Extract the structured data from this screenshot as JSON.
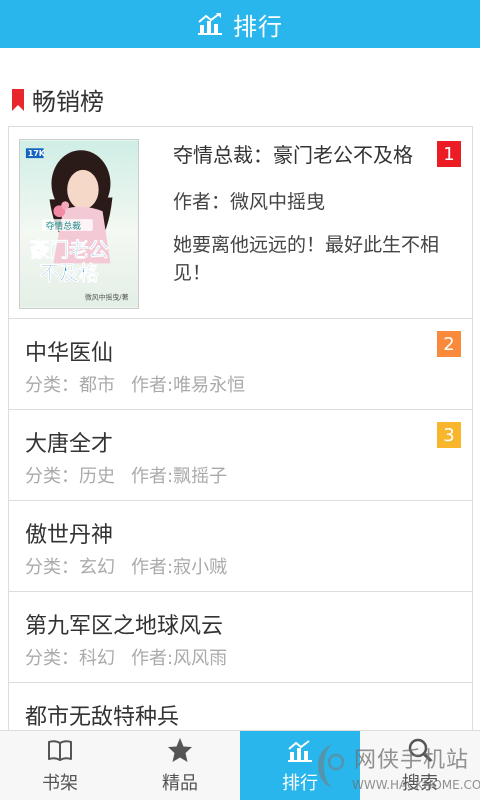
{
  "header": {
    "title": "排行",
    "icon": "bar-chart-icon",
    "color": "#29b6ec"
  },
  "section": {
    "title": "畅销榜",
    "icon": "bookmark-icon",
    "accent": "#e8272d"
  },
  "top_book": {
    "title": "夺情总裁：豪门老公不及格",
    "author": "作者：微风中摇曳",
    "description": " 她要离他远远的！最好此生不相见！",
    "rank": "1",
    "cover": {
      "badge": "17K",
      "title_line1": "豪门老公",
      "title_line2": "不及格",
      "tag": "夺情总裁",
      "author": "微风中摇曳/著"
    }
  },
  "books": [
    {
      "title": "中华医仙",
      "category": "分类：都市",
      "author": "作者:唯易永恒",
      "rank": "2"
    },
    {
      "title": "大唐全才",
      "category": "分类：历史",
      "author": "作者:飘摇子",
      "rank": "3"
    },
    {
      "title": "傲世丹神",
      "category": "分类：玄幻",
      "author": "作者:寂小贼",
      "rank": ""
    },
    {
      "title": "第九军区之地球风云",
      "category": "分类：科幻",
      "author": "作者:风风雨",
      "rank": ""
    },
    {
      "title": "都市无敌特种兵",
      "category": "",
      "author": "",
      "rank": ""
    }
  ],
  "tabs": [
    {
      "label": "书架",
      "icon": "book-icon",
      "active": false
    },
    {
      "label": "精品",
      "icon": "star-icon",
      "active": false
    },
    {
      "label": "排行",
      "icon": "bar-chart-icon",
      "active": true
    },
    {
      "label": "搜索",
      "icon": "search-icon",
      "active": false
    }
  ],
  "watermark": {
    "text": "网侠手机站",
    "url": "WWW.HACKHOME.COM"
  }
}
